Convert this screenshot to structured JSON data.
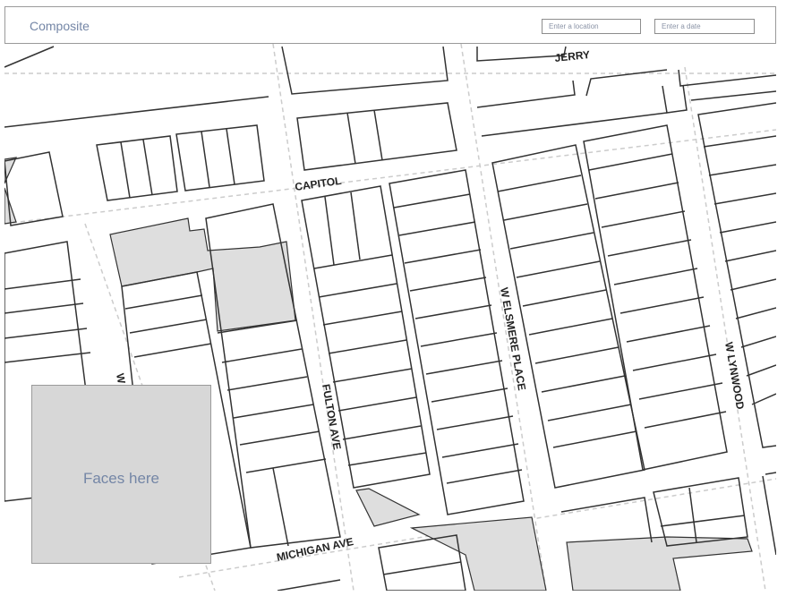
{
  "header": {
    "title": "Composite",
    "location_placeholder": "Enter a location",
    "date_placeholder": "Enter a date"
  },
  "map": {
    "streets": {
      "jerry": "JERRY",
      "capitol": "CAPITOL",
      "fulton": "FULTON AVE",
      "elsmere": "W ELSMERE PLACE",
      "lynwood": "W LYNWOOD",
      "michigan": "MICHIGAN AVE",
      "partial_west": "W"
    },
    "colors": {
      "parcel_stroke": "#333333",
      "park_fill": "#dedede",
      "street_dash": "#cccccc"
    }
  },
  "overlay": {
    "faces_label": "Faces here"
  }
}
